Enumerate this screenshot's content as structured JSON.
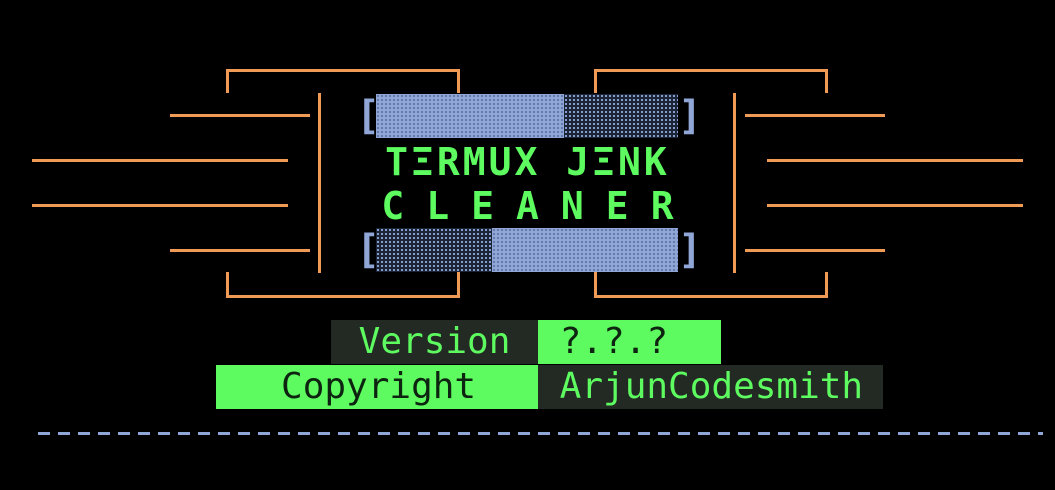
{
  "banner": {
    "title_line_1": "TΞRMUX JΞNK",
    "title_line_2": "CLEANER",
    "bracket_open": "[",
    "bracket_close": "]"
  },
  "info": {
    "version_label": " Version ",
    "version_value": " ?.?.?",
    "copyright_label": "   Copyright ",
    "copyright_value": " ArjunCodesmith"
  },
  "colors": {
    "background": "#000000",
    "frame_orange": "#ef9a55",
    "accent_green": "#5dfb5f",
    "bar_blue": "#8fa6d6",
    "dark_cell": "#232a24"
  }
}
